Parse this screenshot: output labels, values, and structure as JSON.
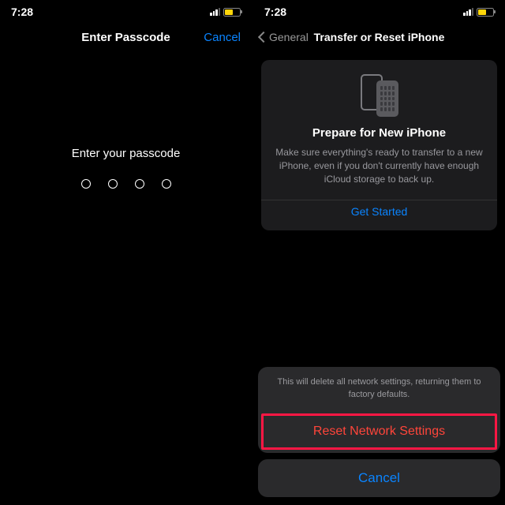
{
  "status": {
    "time": "7:28"
  },
  "left": {
    "nav": {
      "title": "Enter Passcode",
      "cancel": "Cancel"
    },
    "prompt": "Enter your passcode"
  },
  "right": {
    "nav": {
      "back_label": "General",
      "title": "Transfer or Reset iPhone"
    },
    "prepare": {
      "title": "Prepare for New iPhone",
      "desc": "Make sure everything's ready to transfer to a new iPhone, even if you don't currently have enough iCloud storage to back up.",
      "cta": "Get Started"
    },
    "sheet": {
      "message": "This will delete all network settings, returning them to factory defaults.",
      "reset": "Reset Network Settings",
      "cancel": "Cancel"
    }
  }
}
